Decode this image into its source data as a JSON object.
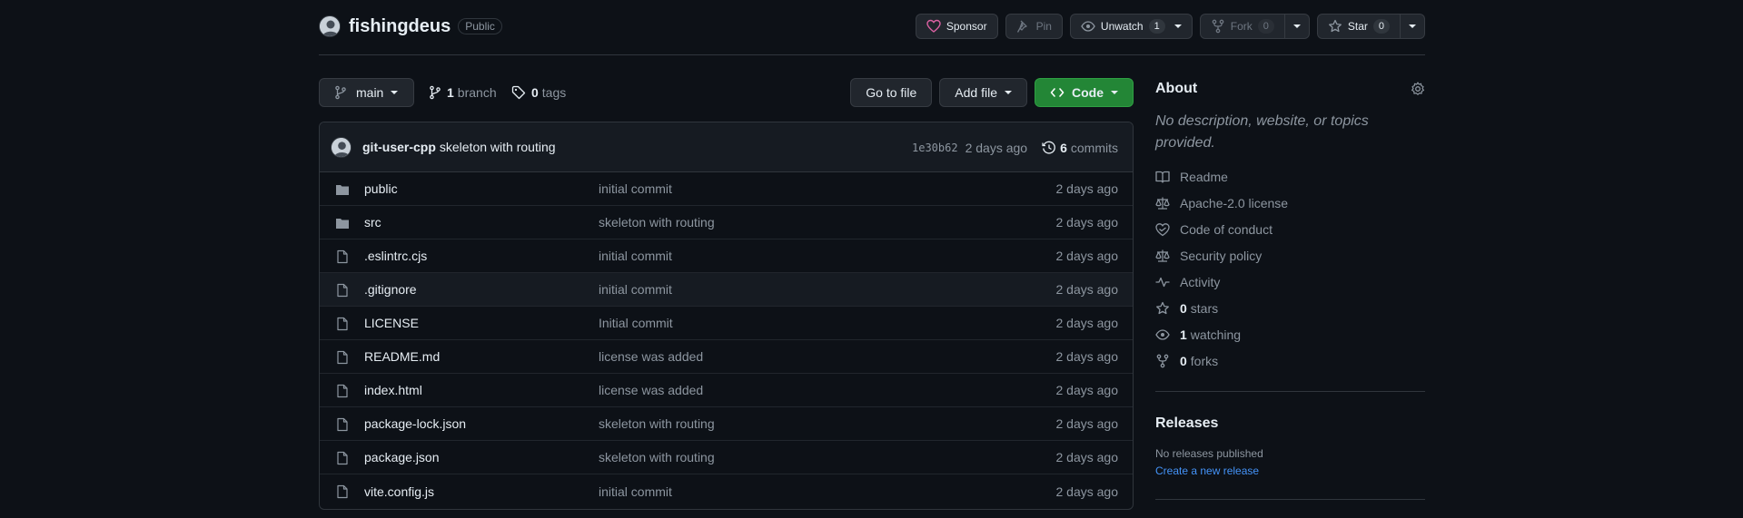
{
  "repo": {
    "owner": "fishingdeus",
    "visibility": "Public"
  },
  "header_actions": {
    "sponsor": "Sponsor",
    "pin": "Pin",
    "watch": "Unwatch",
    "watch_count": "1",
    "fork": "Fork",
    "fork_count": "0",
    "star": "Star",
    "star_count": "0"
  },
  "toolbar": {
    "branch": "main",
    "branch_count": "1",
    "branch_label": "branch",
    "tag_count": "0",
    "tag_label": "tags",
    "go_to_file": "Go to file",
    "add_file": "Add file",
    "code": "Code"
  },
  "latest_commit": {
    "author": "git-user-cpp",
    "message": "skeleton with routing",
    "sha": "1e30b62",
    "age": "2 days ago",
    "count": "6",
    "count_label": "commits"
  },
  "files": [
    {
      "type": "folder",
      "name": "public",
      "commit": "initial commit",
      "age": "2 days ago"
    },
    {
      "type": "folder",
      "name": "src",
      "commit": "skeleton with routing",
      "age": "2 days ago"
    },
    {
      "type": "file",
      "name": ".eslintrc.cjs",
      "commit": "initial commit",
      "age": "2 days ago"
    },
    {
      "type": "file",
      "name": ".gitignore",
      "commit": "initial commit",
      "age": "2 days ago"
    },
    {
      "type": "file",
      "name": "LICENSE",
      "commit": "Initial commit",
      "age": "2 days ago"
    },
    {
      "type": "file",
      "name": "README.md",
      "commit": "license was added",
      "age": "2 days ago"
    },
    {
      "type": "file",
      "name": "index.html",
      "commit": "license was added",
      "age": "2 days ago"
    },
    {
      "type": "file",
      "name": "package-lock.json",
      "commit": "skeleton with routing",
      "age": "2 days ago"
    },
    {
      "type": "file",
      "name": "package.json",
      "commit": "skeleton with routing",
      "age": "2 days ago"
    },
    {
      "type": "file",
      "name": "vite.config.js",
      "commit": "initial commit",
      "age": "2 days ago"
    }
  ],
  "about": {
    "title": "About",
    "description": "No description, website, or topics provided.",
    "items": [
      {
        "icon": "book-icon",
        "label": "Readme"
      },
      {
        "icon": "law-icon",
        "label": "Apache-2.0 license"
      },
      {
        "icon": "code-of-conduct-icon",
        "label": "Code of conduct"
      },
      {
        "icon": "law-icon",
        "label": "Security policy"
      },
      {
        "icon": "pulse-icon",
        "label": "Activity"
      },
      {
        "icon": "star-icon",
        "count": "0",
        "label": "stars"
      },
      {
        "icon": "eye-icon",
        "count": "1",
        "label": "watching"
      },
      {
        "icon": "fork-icon",
        "count": "0",
        "label": "forks"
      }
    ]
  },
  "releases": {
    "title": "Releases",
    "none": "No releases published",
    "create": "Create a new release"
  },
  "colors": {
    "background": "#0d1117",
    "accent_green": "#238636",
    "link_blue": "#4493f8",
    "sponsor_pink": "#db61a2"
  }
}
